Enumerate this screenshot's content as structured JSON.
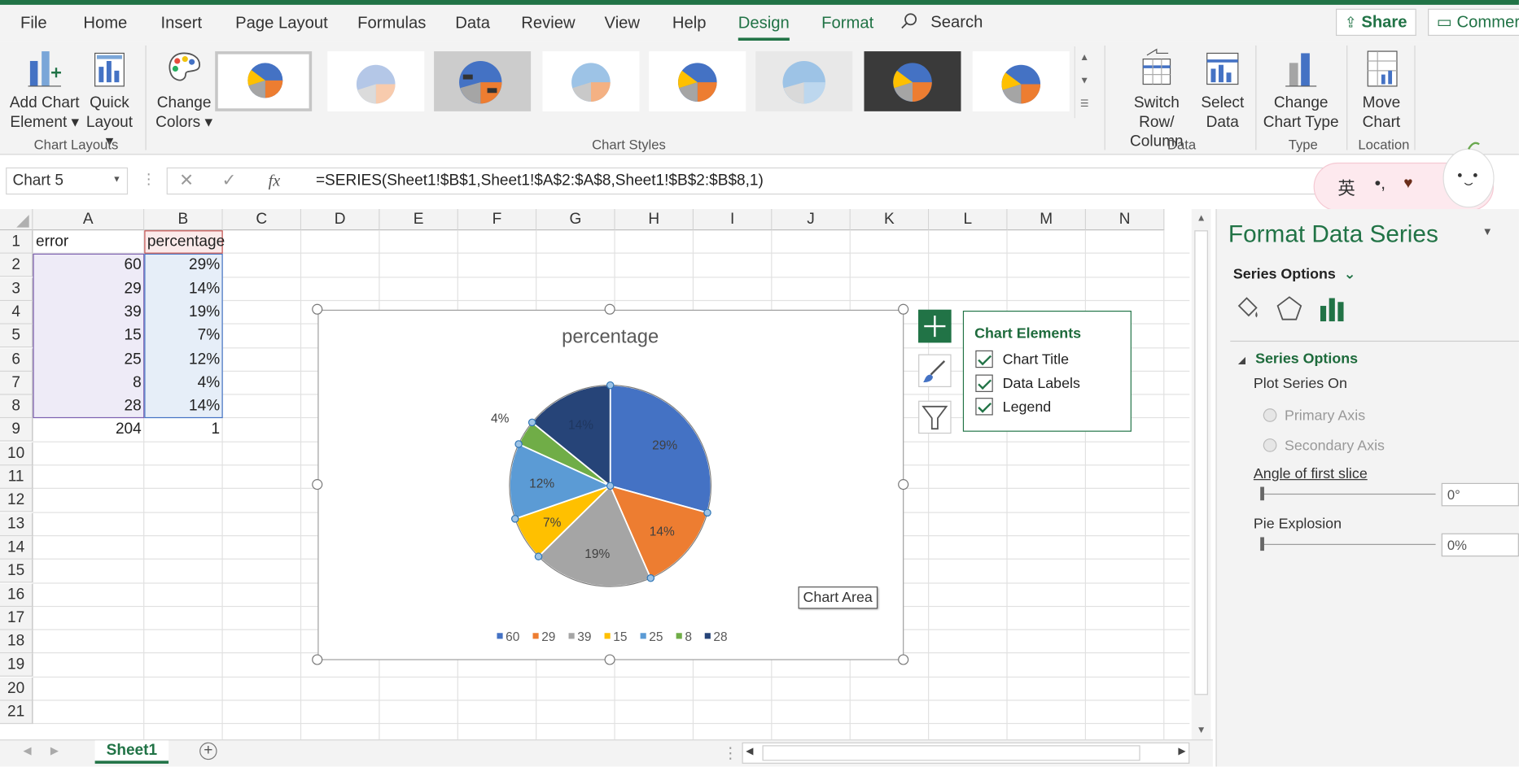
{
  "menu": {
    "items": [
      "File",
      "Home",
      "Insert",
      "Page Layout",
      "Formulas",
      "Data",
      "Review",
      "View",
      "Help",
      "Design",
      "Format"
    ],
    "search_label": "Search",
    "share_label": "Share",
    "comments_label": "Commer"
  },
  "ribbon": {
    "add_chart_element": [
      "Add Chart",
      "Element ▾"
    ],
    "quick_layout": [
      "Quick",
      "Layout ▾"
    ],
    "change_colors": [
      "Change",
      "Colors ▾"
    ],
    "switch_row_col": [
      "Switch Row/",
      "Column"
    ],
    "select_data": [
      "Select",
      "Data"
    ],
    "change_chart_type": [
      "Change",
      "Chart Type"
    ],
    "move_chart": [
      "Move",
      "Chart"
    ],
    "groups": {
      "chart_layouts": "Chart Layouts",
      "chart_styles": "Chart Styles",
      "data": "Data",
      "type": "Type",
      "location": "Location"
    }
  },
  "formula_bar": {
    "name_box": "Chart 5",
    "fx": "fx",
    "formula": "=SERIES(Sheet1!$B$1,Sheet1!$A$2:$A$8,Sheet1!$B$2:$B$8,1)"
  },
  "sheet": {
    "columns": [
      "A",
      "B",
      "C",
      "D",
      "E",
      "F",
      "G",
      "H",
      "I",
      "J",
      "K",
      "L",
      "M",
      "N"
    ],
    "rows": [
      "1",
      "2",
      "3",
      "4",
      "5",
      "6",
      "7",
      "8",
      "9",
      "10",
      "11",
      "12",
      "13",
      "14",
      "15",
      "16",
      "17",
      "18",
      "19",
      "20",
      "21"
    ],
    "cells": {
      "A1": "error",
      "B1": "percentage",
      "A2": "60",
      "B2": "29%",
      "A3": "29",
      "B3": "14%",
      "A4": "39",
      "B4": "19%",
      "A5": "15",
      "B5": "7%",
      "A6": "25",
      "B6": "12%",
      "A7": "8",
      "B7": "4%",
      "A8": "28",
      "B8": "14%",
      "A9": "204",
      "B9": "1"
    },
    "tab": "Sheet1"
  },
  "chart_data": {
    "type": "pie",
    "title": "percentage",
    "categories": [
      "60",
      "29",
      "39",
      "15",
      "25",
      "8",
      "28"
    ],
    "values": [
      29,
      14,
      19,
      7,
      12,
      4,
      14
    ],
    "data_labels": [
      "29%",
      "14%",
      "19%",
      "7%",
      "12%",
      "4%",
      "14%"
    ],
    "colors": [
      "#4472c4",
      "#ed7d31",
      "#a5a5a5",
      "#ffc000",
      "#5b9bd5",
      "#70ad47",
      "#264478"
    ],
    "legend_position": "bottom"
  },
  "chart_elements": {
    "title": "Chart Elements",
    "items": [
      "Chart Title",
      "Data Labels",
      "Legend"
    ]
  },
  "tooltip": "Chart Area",
  "pane": {
    "title": "Format Data Series",
    "series_options_dropdown": "Series Options",
    "section": "Series Options",
    "plot_on": "Plot Series On",
    "primary_axis": "Primary Axis",
    "secondary_axis": "Secondary Axis",
    "angle_label": "Angle of first slice",
    "angle_value": "0°",
    "explosion_label": "Pie Explosion",
    "explosion_value": "0%"
  },
  "ime": {
    "char": "英"
  },
  "colors": {
    "accent": "#217346"
  }
}
